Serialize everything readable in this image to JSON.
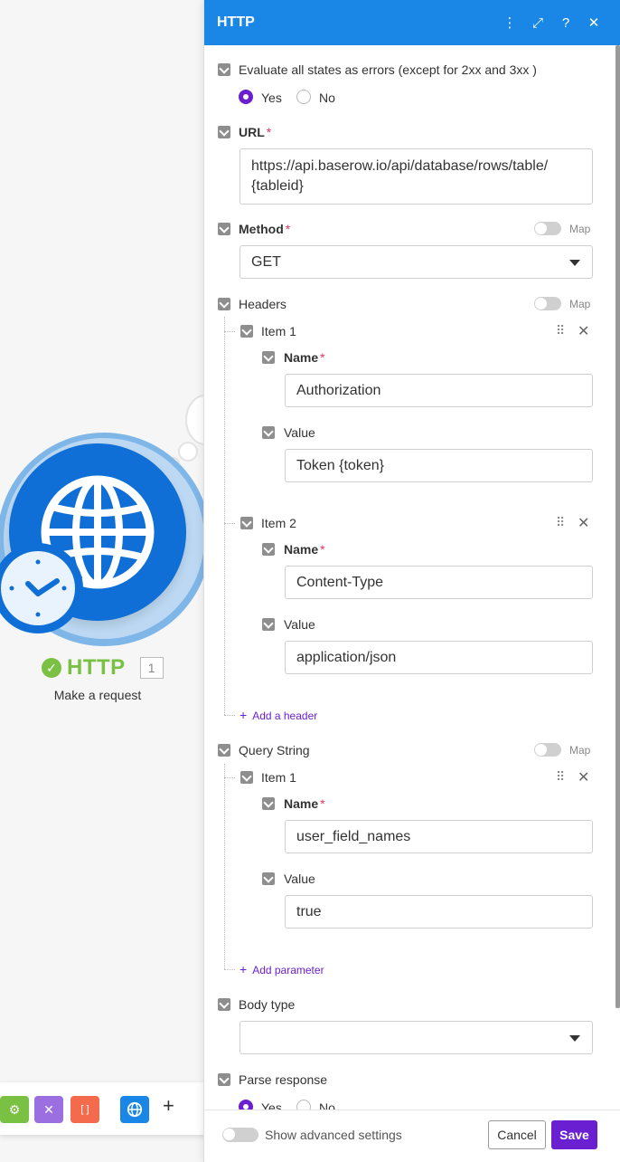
{
  "module": {
    "name": "HTTP",
    "number": "1",
    "subtitle": "Make a request"
  },
  "panel": {
    "title": "HTTP",
    "header_icons": [
      "kebab-menu-icon",
      "expand-icon",
      "help-icon",
      "close-icon"
    ]
  },
  "fields": {
    "evaluate_label": "Evaluate all states as errors (except for 2xx and 3xx )",
    "evaluate_yes": "Yes",
    "evaluate_no": "No",
    "url_label": "URL",
    "url_value_line1": "https://api.baserow.io/api/database/rows/table/",
    "url_value_line2": "{tableid}",
    "method_label": "Method",
    "method_value": "GET",
    "map_label": "Map",
    "headers_label": "Headers",
    "headers_items": [
      {
        "item_label": "Item 1",
        "name_label": "Name",
        "name_value": "Authorization",
        "value_label": "Value",
        "value_value": "Token {token}"
      },
      {
        "item_label": "Item 2",
        "name_label": "Name",
        "name_value": "Content-Type",
        "value_label": "Value",
        "value_value": "application/json"
      }
    ],
    "add_header": "Add a header",
    "query_label": "Query String",
    "query_items": [
      {
        "item_label": "Item 1",
        "name_label": "Name",
        "name_value": "user_field_names",
        "value_label": "Value",
        "value_value": "true"
      }
    ],
    "add_parameter": "Add parameter",
    "body_type_label": "Body type",
    "body_type_value": "",
    "parse_label": "Parse response",
    "parse_yes": "Yes",
    "parse_no": "No",
    "required_mark": "*",
    "add_icon": "+"
  },
  "footer": {
    "advanced_label": "Show advanced settings",
    "cancel": "Cancel",
    "save": "Save"
  },
  "colors": {
    "header_bg": "#1a87e6",
    "accent_purple": "#6a1fd1",
    "module_blue": "#0f6fd6",
    "success_green": "#7ac143"
  }
}
